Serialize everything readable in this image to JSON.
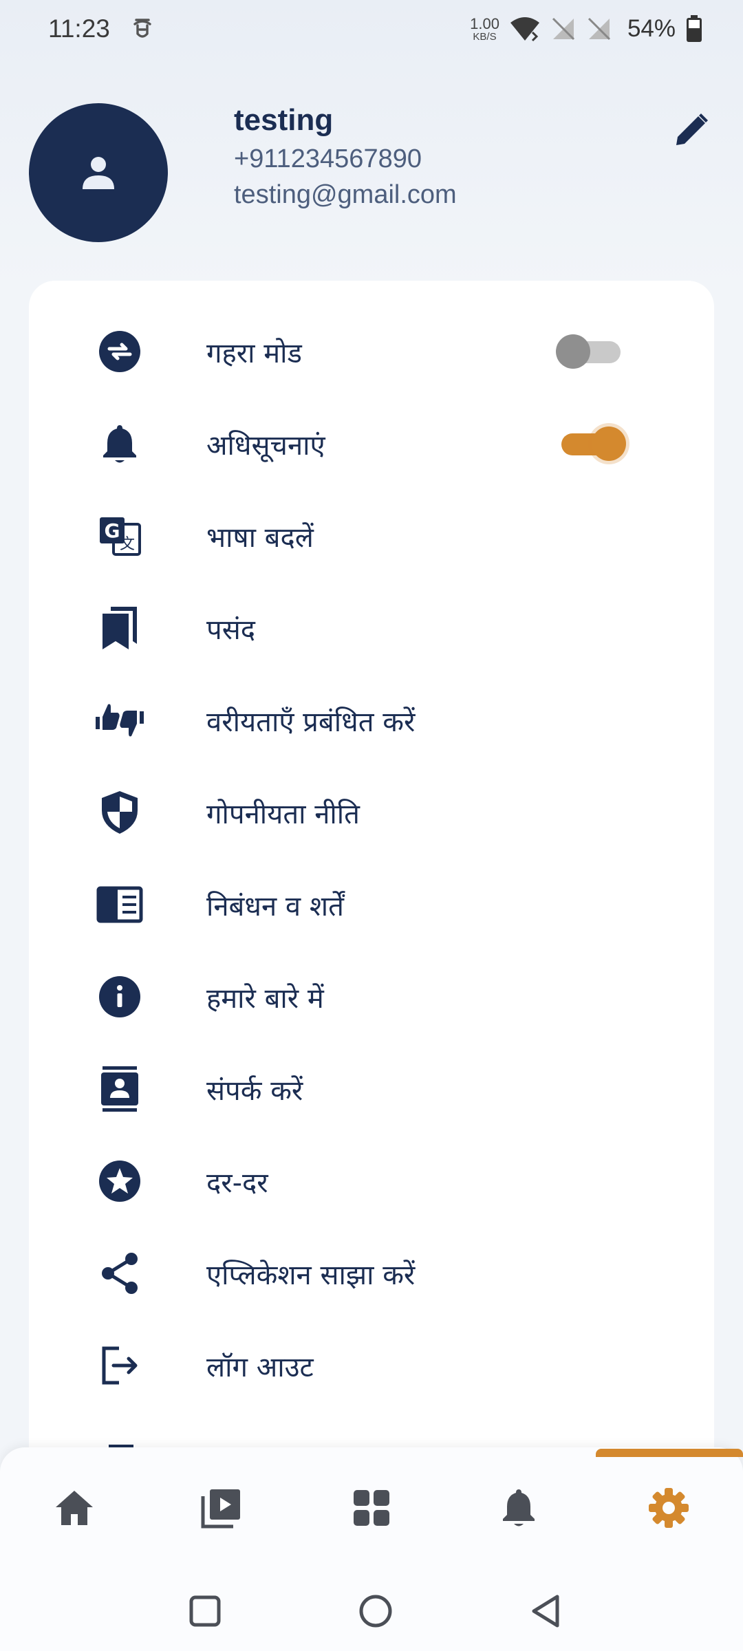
{
  "status_bar": {
    "time": "11:23",
    "net_speed_value": "1.00",
    "net_speed_unit": "KB/S",
    "battery": "54%"
  },
  "profile": {
    "name": "testing",
    "phone": "+911234567890",
    "email": "testing@gmail.com"
  },
  "menu": {
    "items": [
      {
        "label": "गहरा मोड",
        "icon": "swap-icon",
        "toggle": "off"
      },
      {
        "label": "अधिसूचनाएं",
        "icon": "bell-icon",
        "toggle": "on"
      },
      {
        "label": "भाषा बदलें",
        "icon": "translate-icon"
      },
      {
        "label": "पसंद",
        "icon": "bookmarks-icon"
      },
      {
        "label": "वरीयताएँ प्रबंधित करें",
        "icon": "thumbs-icon"
      },
      {
        "label": "गोपनीयता नीति",
        "icon": "shield-icon"
      },
      {
        "label": "निबंधन व शर्तें",
        "icon": "book-icon"
      },
      {
        "label": "हमारे बारे में",
        "icon": "info-icon"
      },
      {
        "label": "संपर्क करें",
        "icon": "contact-icon"
      },
      {
        "label": "दर-दर",
        "icon": "star-icon"
      },
      {
        "label": "एप्लिकेशन साझा करें",
        "icon": "share-icon"
      },
      {
        "label": "लॉग आउट",
        "icon": "logout-icon"
      }
    ]
  },
  "bottom_nav": {
    "items": [
      "home-icon",
      "video-library-icon",
      "grid-icon",
      "notifications-icon",
      "settings-icon"
    ],
    "active": "settings-icon",
    "accent_color": "#d4892e"
  },
  "colors": {
    "primary": "#1b2d52",
    "accent": "#d4892e"
  }
}
